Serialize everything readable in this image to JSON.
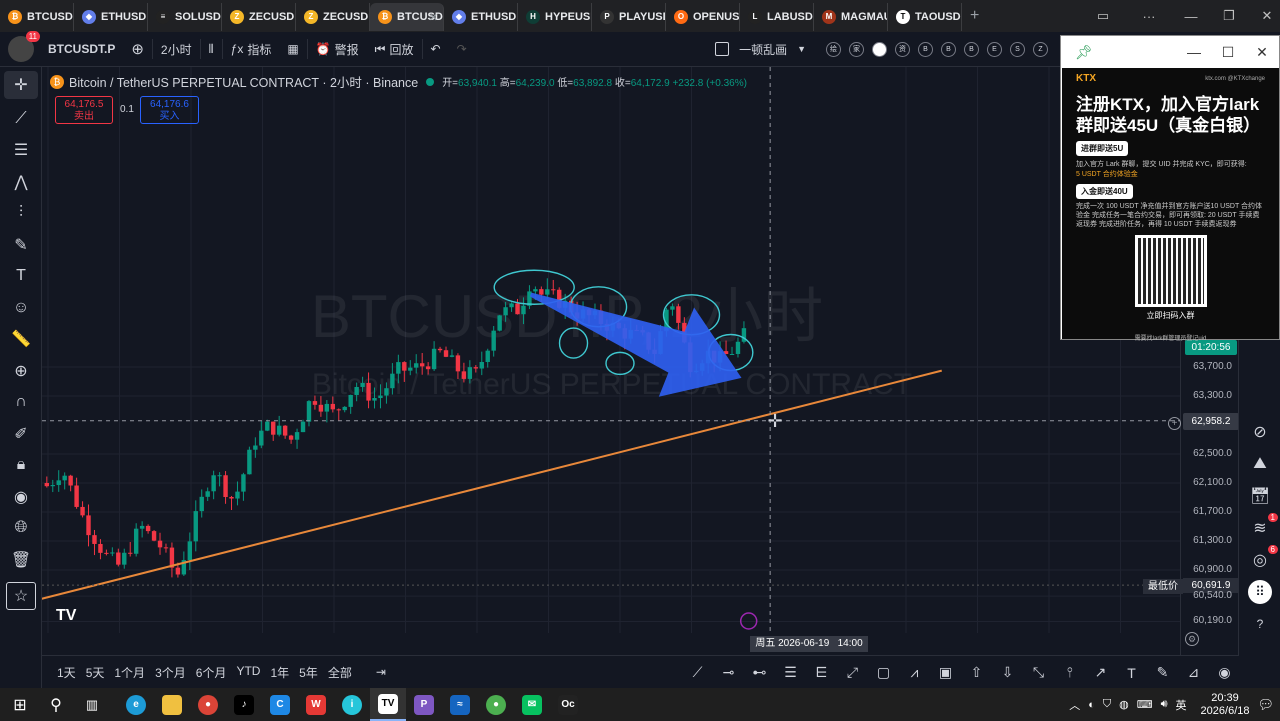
{
  "browser": {
    "tabs": [
      {
        "label": "BTCUSD",
        "color": "#f7931a",
        "glyph": "₿"
      },
      {
        "label": "ETHUSD",
        "color": "#627eea",
        "glyph": "◆"
      },
      {
        "label": "SOLUSD",
        "color": "#222",
        "glyph": "≡"
      },
      {
        "label": "ZECUSD",
        "color": "#f4b728",
        "glyph": "Z"
      },
      {
        "label": "ZECUSD",
        "color": "#f4b728",
        "glyph": "Z"
      },
      {
        "label": "BTCUSD",
        "color": "#f7931a",
        "glyph": "₿",
        "active": true
      },
      {
        "label": "ETHUSD",
        "color": "#627eea",
        "glyph": "◆"
      },
      {
        "label": "HYPEUSD",
        "color": "#0f3d35",
        "glyph": "H"
      },
      {
        "label": "PLAYUSD",
        "color": "#333",
        "glyph": "P"
      },
      {
        "label": "OPENUSD",
        "color": "#ff6a13",
        "glyph": "O"
      },
      {
        "label": "LABUSD",
        "color": "#222",
        "glyph": "L"
      },
      {
        "label": "MAGMAUSD",
        "color": "#a0341a",
        "glyph": "M"
      },
      {
        "label": "TAOUSD",
        "color": "#fff",
        "glyph": "T"
      }
    ]
  },
  "toolbar": {
    "symbol": "BTCUSDT.P",
    "interval": "2小时",
    "indicators": "指标",
    "alerts": "警报",
    "replay": "回放",
    "layout_name": "一顿乱画",
    "avatar_badge": "11",
    "circle_buttons": [
      "绘",
      "家",
      "",
      "资",
      "B",
      "B",
      "B",
      "E",
      "S",
      "Z"
    ]
  },
  "legend": {
    "title": "Bitcoin / TetherUS PERPETUAL CONTRACT · 2小时 · Binance",
    "open_label": "开=",
    "open": "63,940.1",
    "high_label": "高=",
    "high": "64,239.0",
    "low_label": "低=",
    "low": "63,892.8",
    "close_label": "收=",
    "close": "64,172.9",
    "change": "+232.8 (+0.36%)"
  },
  "orders": {
    "sell_price": "64,176.5",
    "sell_label": "卖出",
    "spread": "0.1",
    "buy_price": "64,176.6",
    "buy_label": "买入"
  },
  "watermark": {
    "line1": "BTCUSDT.P, 2小时",
    "line2": "Bitcoin / TetherUS PERPETUAL CONTRACT"
  },
  "price_scale": {
    "ticks": [
      {
        "label": "63,700.0",
        "price": 63700
      },
      {
        "label": "63,300.0",
        "price": 63300
      },
      {
        "label": "62,500.0",
        "price": 62500
      },
      {
        "label": "62,100.0",
        "price": 62100
      },
      {
        "label": "61,700.0",
        "price": 61700
      },
      {
        "label": "61,300.0",
        "price": 61300
      },
      {
        "label": "60,900.0",
        "price": 60900
      },
      {
        "label": "60,540.0",
        "price": 60540
      },
      {
        "label": "60,190.0",
        "price": 60190
      }
    ],
    "countdown": "01:20:56",
    "crosshair_price": "62,958.2",
    "low_label": "最低价",
    "low_price": "60,691.9"
  },
  "time_scale": {
    "ticks": [
      {
        "label": "9",
        "day": 9
      },
      {
        "label": "10",
        "day": 10
      },
      {
        "label": "11",
        "day": 11
      },
      {
        "label": "12",
        "day": 12
      },
      {
        "label": "13",
        "day": 13
      },
      {
        "label": "14",
        "day": 14
      },
      {
        "label": "15",
        "day": 15
      },
      {
        "label": "16",
        "day": 16
      },
      {
        "label": "17",
        "day": 17
      },
      {
        "label": "18",
        "day": 18
      },
      {
        "label": "21",
        "day": 21
      },
      {
        "label": "22",
        "day": 22
      },
      {
        "label": "23",
        "day": 23
      },
      {
        "label": "24",
        "day": 24
      }
    ],
    "crosshair_label": "周五 2026-06-19   14:00"
  },
  "ranges": [
    "1天",
    "5天",
    "1个月",
    "3个月",
    "6个月",
    "YTD",
    "1年",
    "5年",
    "全部"
  ],
  "right_badges": {
    "notifications": "1",
    "ideas": "6"
  },
  "popup": {
    "brand": "KTX",
    "site": "ktx.com  @KTXchange",
    "headline": "注册KTX，加入官方lark群即送45U（真金白银）",
    "pill1": "进群即送5U",
    "text1": "加入官方 Lark 群聊，提交 UID 并完成 KYC，即可获得:",
    "reward1": "5 USDT 合约体验金",
    "pill2": "入金即送40U",
    "text2": "完成一次 100 USDT 净充值并到官方账户送10 USDT 合约体验金 完成任务一笔合约交易，即可再领取: 20 USDT 手续费返现券 完成进阶任务，再得 10 USDT 手续费返现券",
    "qr_caption": "立即扫码入群",
    "footer": "需要找lark群管理员登记uid"
  },
  "taskbar": {
    "time": "20:39",
    "date": "2026/6/18",
    "ime": "英"
  },
  "chart_data": {
    "type": "candlestick",
    "symbol": "BTCUSDT.P",
    "interval": "2h",
    "exchange": "Binance",
    "x_unit": "day of June 2026",
    "ylim": [
      60100,
      64900
    ],
    "last": {
      "open": 63940.1,
      "high": 64239.0,
      "low": 63892.8,
      "close": 64172.9,
      "change": 232.8,
      "change_pct": 0.36
    },
    "path": [
      [
        8.9,
        62100
      ],
      [
        9.0,
        62050
      ],
      [
        9.2,
        62300
      ],
      [
        9.5,
        61600
      ],
      [
        9.8,
        61100
      ],
      [
        10.0,
        60950
      ],
      [
        10.3,
        61500
      ],
      [
        10.6,
        61200
      ],
      [
        10.8,
        60800
      ],
      [
        11.0,
        61400
      ],
      [
        11.3,
        62300
      ],
      [
        11.6,
        61850
      ],
      [
        11.9,
        62700
      ],
      [
        12.1,
        62900
      ],
      [
        12.4,
        62700
      ],
      [
        12.7,
        63300
      ],
      [
        13.0,
        63050
      ],
      [
        13.3,
        63450
      ],
      [
        13.6,
        63250
      ],
      [
        13.9,
        63650
      ],
      [
        14.2,
        63700
      ],
      [
        14.5,
        63900
      ],
      [
        14.8,
        63600
      ],
      [
        15.0,
        63600
      ],
      [
        15.3,
        64450
      ],
      [
        15.6,
        64500
      ],
      [
        15.75,
        64900
      ],
      [
        15.9,
        64700
      ],
      [
        16.1,
        64650
      ],
      [
        16.4,
        64450
      ],
      [
        16.7,
        64350
      ],
      [
        17.0,
        64200
      ],
      [
        17.3,
        64100
      ],
      [
        17.5,
        63900
      ],
      [
        17.7,
        64700
      ],
      [
        17.9,
        64000
      ],
      [
        18.0,
        63700
      ],
      [
        18.2,
        63900
      ],
      [
        18.4,
        63800
      ],
      [
        18.6,
        63950
      ],
      [
        18.75,
        64150
      ]
    ],
    "trendline": [
      [
        8.9,
        60500
      ],
      [
        21.5,
        63650
      ]
    ],
    "arrow_start": [
      15.75,
      64700
    ],
    "arrow_end": [
      18.7,
      63550
    ]
  }
}
